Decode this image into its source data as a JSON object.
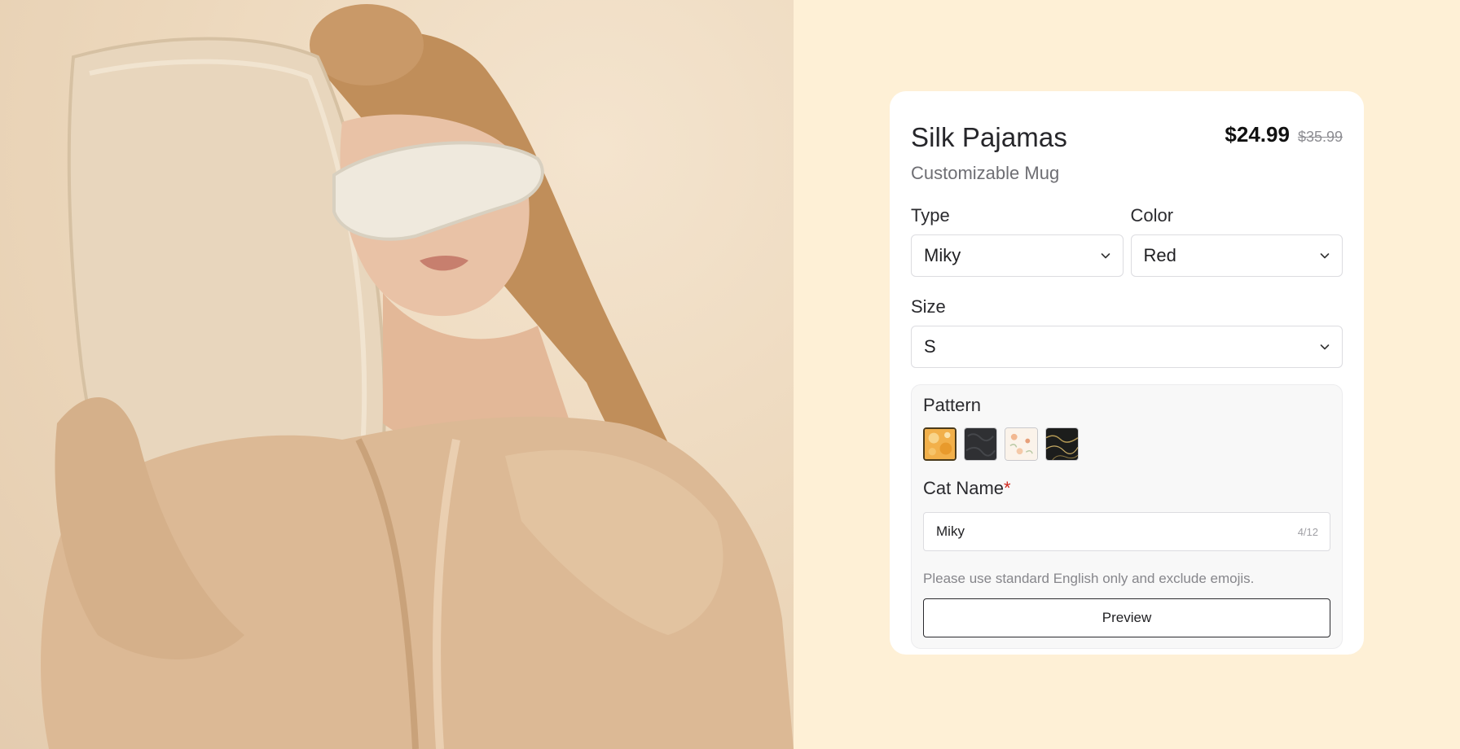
{
  "product": {
    "title": "Silk Pajamas",
    "subtitle": "Customizable Mug",
    "price": "$24.99",
    "original_price": "$35.99"
  },
  "options": {
    "type": {
      "label": "Type",
      "value": "Miky"
    },
    "color": {
      "label": "Color",
      "value": "Red"
    },
    "size": {
      "label": "Size",
      "value": "S"
    }
  },
  "pattern": {
    "label": "Pattern",
    "swatches": [
      "orange-floral",
      "dark-charcoal",
      "cream-floral",
      "black-gold-marble"
    ],
    "selected_index": 0
  },
  "cat_name": {
    "label": "Cat Name",
    "required_mark": "*",
    "value": "Miky",
    "counter": "4/12",
    "hint": "Please use standard English only and exclude emojis."
  },
  "actions": {
    "preview_label": "Preview"
  },
  "photo": {
    "subject": "woman-in-satin-pajamas-with-pillow-and-sleep-mask"
  },
  "colors": {
    "page_bg": "#fef0d6",
    "card_bg": "#ffffff",
    "required": "#d0271d"
  }
}
